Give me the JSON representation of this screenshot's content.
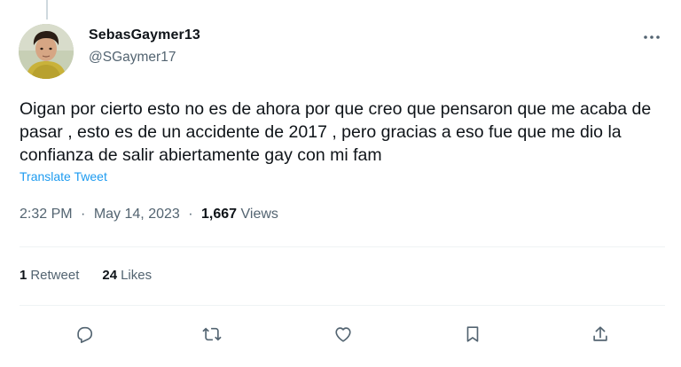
{
  "author": {
    "display_name": "SebasGaymer13",
    "handle": "@SGaymer17",
    "avatar_icon": "user-avatar"
  },
  "tweet": {
    "text": "Oigan por cierto esto no es de ahora por que creo que pensaron que me acaba de pasar , esto es de un accidente de 2017 , pero gracias a eso fue que me dio la confianza de salir abiertamente gay con mi fam",
    "translate_label": "Translate Tweet",
    "time": "2:32 PM",
    "separator": "·",
    "date": "May 14, 2023",
    "views_count": "1,667",
    "views_label": "Views"
  },
  "stats": {
    "retweets_count": "1",
    "retweets_label": "Retweet",
    "likes_count": "24",
    "likes_label": "Likes"
  },
  "actions": {
    "icons": [
      "reply-icon",
      "retweet-icon",
      "like-icon",
      "bookmark-icon",
      "share-icon"
    ]
  },
  "more_icon": "more-icon",
  "colors": {
    "text_primary": "#0f1419",
    "text_secondary": "#536471",
    "link": "#1d9bf0",
    "divider": "#eff3f4"
  }
}
